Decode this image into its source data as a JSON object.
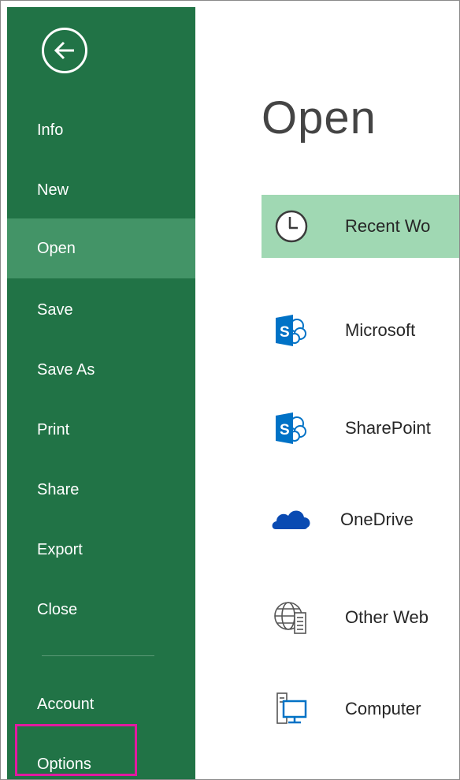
{
  "sidebar": {
    "back_icon": "back-arrow-icon",
    "items": [
      {
        "label": "Info",
        "active": false
      },
      {
        "label": "New",
        "active": false
      },
      {
        "label": "Open",
        "active": true
      },
      {
        "label": "Save",
        "active": false
      },
      {
        "label": "Save As",
        "active": false
      },
      {
        "label": "Print",
        "active": false
      },
      {
        "label": "Share",
        "active": false
      },
      {
        "label": "Export",
        "active": false
      },
      {
        "label": "Close",
        "active": false
      }
    ],
    "bottom_items": [
      {
        "label": "Account"
      },
      {
        "label": "Options",
        "highlighted": true
      }
    ]
  },
  "main": {
    "title": "Open",
    "places": [
      {
        "label": "Recent Wo",
        "icon": "clock-icon",
        "active": true
      },
      {
        "label": "Microsoft",
        "icon": "sharepoint-icon",
        "active": false
      },
      {
        "label": "SharePoint",
        "icon": "sharepoint-icon",
        "active": false
      },
      {
        "label": "OneDrive",
        "icon": "cloud-icon",
        "active": false
      },
      {
        "label": "Other Web",
        "icon": "globe-icon",
        "active": false
      },
      {
        "label": "Computer",
        "icon": "computer-icon",
        "active": false
      }
    ]
  },
  "colors": {
    "sidebar_bg": "#217346",
    "sidebar_active": "#439467",
    "place_active": "#a0d8b3",
    "highlight_box": "#e21aa0",
    "sharepoint_blue": "#0072c6",
    "onedrive_blue": "#094ab2"
  }
}
